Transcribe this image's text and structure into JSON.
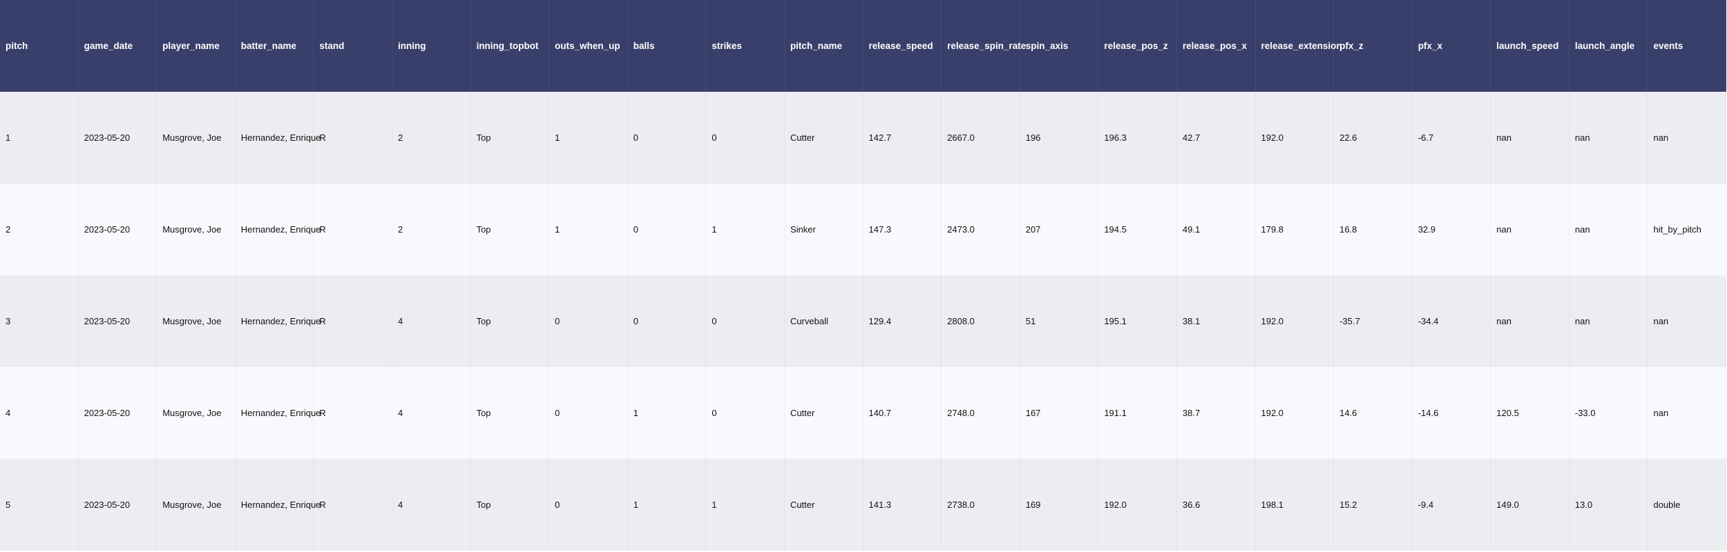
{
  "table": {
    "columns": [
      "pitch",
      "game_date",
      "player_name",
      "batter_name",
      "stand",
      "inning",
      "inning_topbot",
      "outs_when_up",
      "balls",
      "strikes",
      "pitch_name",
      "release_speed",
      "release_spin_rate",
      "spin_axis",
      "release_pos_z",
      "release_pos_x",
      "release_extension",
      "pfx_z",
      "pfx_x",
      "launch_speed",
      "launch_angle",
      "events"
    ],
    "rows": [
      [
        "1",
        "2023-05-20",
        "Musgrove, Joe",
        "Hernandez, Enrique",
        "R",
        "2",
        "Top",
        "1",
        "0",
        "0",
        "Cutter",
        "142.7",
        "2667.0",
        "196",
        "196.3",
        "42.7",
        "192.0",
        "22.6",
        "-6.7",
        "nan",
        "nan",
        "nan"
      ],
      [
        "2",
        "2023-05-20",
        "Musgrove, Joe",
        "Hernandez, Enrique",
        "R",
        "2",
        "Top",
        "1",
        "0",
        "1",
        "Sinker",
        "147.3",
        "2473.0",
        "207",
        "194.5",
        "49.1",
        "179.8",
        "16.8",
        "32.9",
        "nan",
        "nan",
        "hit_by_pitch"
      ],
      [
        "3",
        "2023-05-20",
        "Musgrove, Joe",
        "Hernandez, Enrique",
        "R",
        "4",
        "Top",
        "0",
        "0",
        "0",
        "Curveball",
        "129.4",
        "2808.0",
        "51",
        "195.1",
        "38.1",
        "192.0",
        "-35.7",
        "-34.4",
        "nan",
        "nan",
        "nan"
      ],
      [
        "4",
        "2023-05-20",
        "Musgrove, Joe",
        "Hernandez, Enrique",
        "R",
        "4",
        "Top",
        "0",
        "1",
        "0",
        "Cutter",
        "140.7",
        "2748.0",
        "167",
        "191.1",
        "38.7",
        "192.0",
        "14.6",
        "-14.6",
        "120.5",
        "-33.0",
        "nan"
      ],
      [
        "5",
        "2023-05-20",
        "Musgrove, Joe",
        "Hernandez, Enrique",
        "R",
        "4",
        "Top",
        "0",
        "1",
        "1",
        "Cutter",
        "141.3",
        "2738.0",
        "169",
        "192.0",
        "36.6",
        "198.1",
        "15.2",
        "-9.4",
        "149.0",
        "13.0",
        "double"
      ]
    ]
  },
  "colors": {
    "header_bg": "#393f6b",
    "row_odd_bg": "#ecedf0",
    "row_even_bg": "#f7f9fc"
  }
}
